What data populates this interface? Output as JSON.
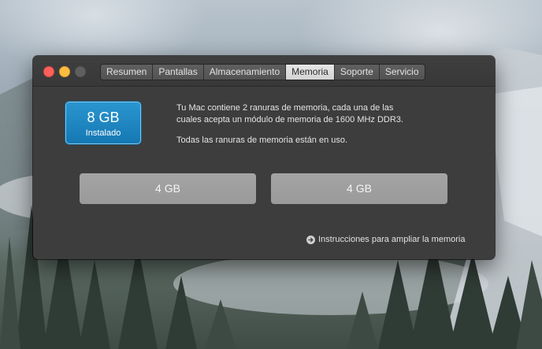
{
  "window": {
    "tabs": [
      {
        "label": "Resumen",
        "active": false
      },
      {
        "label": "Pantallas",
        "active": false
      },
      {
        "label": "Almacenamiento",
        "active": false
      },
      {
        "label": "Memoria",
        "active": true
      },
      {
        "label": "Soporte",
        "active": false
      },
      {
        "label": "Servicio",
        "active": false
      }
    ]
  },
  "memory": {
    "installed_size": "8 GB",
    "installed_label": "Instalado",
    "description_line1": "Tu Mac contiene 2 ranuras de memoria, cada una de las",
    "description_line2": "cuales acepta un módulo de memoria de 1600 MHz DDR3.",
    "slots_status": "Todas las ranuras de memoria están en uso.",
    "slots": [
      {
        "label": "4 GB"
      },
      {
        "label": "4 GB"
      }
    ],
    "upgrade_link": "Instrucciones para ampliar la memoria"
  },
  "colors": {
    "accent": "#1a84c1",
    "window_bg": "#3d3d3d",
    "slot_bg": "#a0a0a0"
  }
}
